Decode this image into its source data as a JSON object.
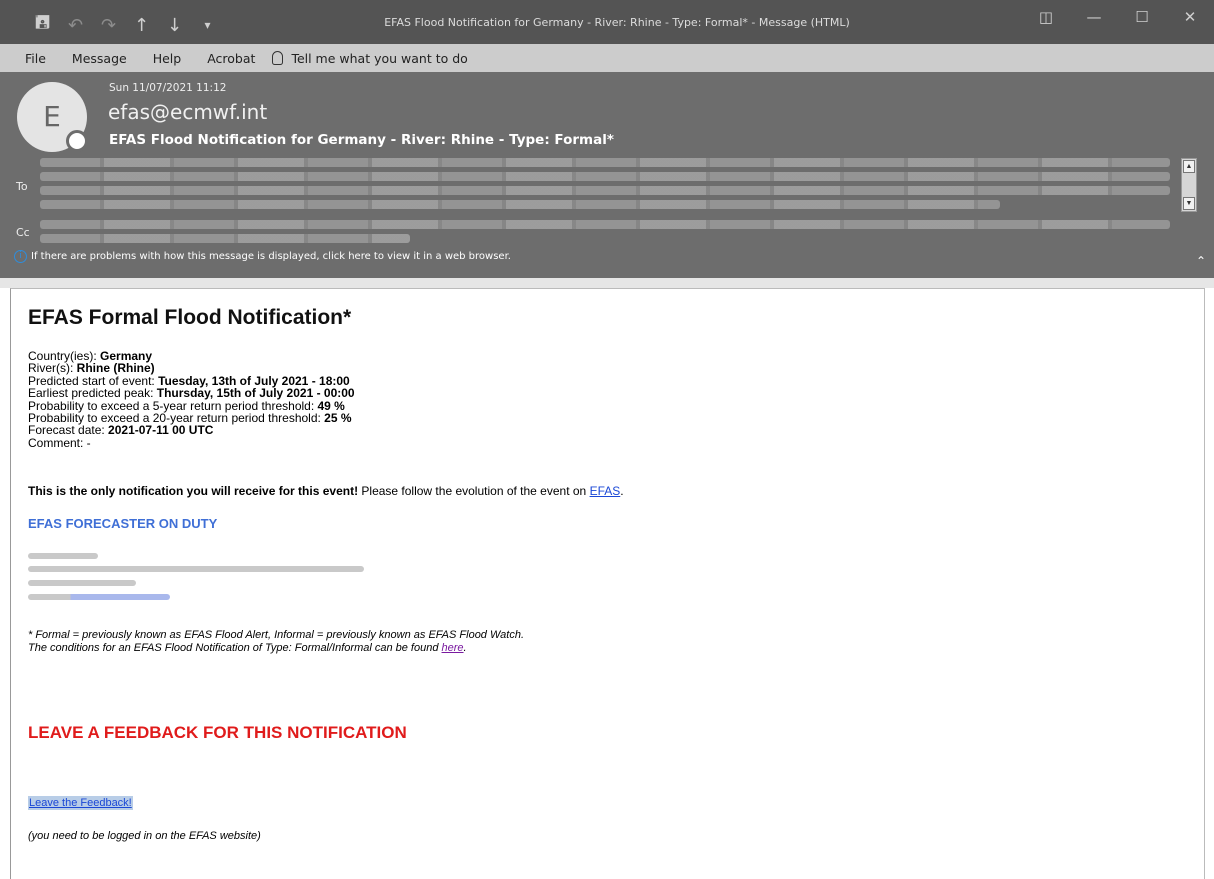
{
  "titlebar": {
    "title": "EFAS Flood Notification for Germany - River: Rhine - Type: Formal* - Message (HTML)",
    "qat_icons": [
      "save-icon",
      "undo-icon",
      "redo-icon",
      "up-arrow-icon",
      "down-arrow-icon",
      "customize-qat-icon"
    ]
  },
  "menu": {
    "items": [
      "File",
      "Message",
      "Help",
      "Acrobat"
    ],
    "tell_me": "Tell me what you want to do"
  },
  "header": {
    "avatar_letter": "E",
    "date": "Sun 11/07/2021 11:12",
    "sender": "efas@ecmwf.int",
    "subject": "EFAS Flood Notification for Germany - River: Rhine - Type: Formal*",
    "to_label": "To",
    "cc_label": "Cc",
    "info": "If there are problems with how this message is displayed, click here to view it in a web browser."
  },
  "body": {
    "heading": "EFAS Formal Flood Notification*",
    "details": [
      {
        "label": "Country(ies): ",
        "value": "Germany",
        "suffix": ""
      },
      {
        "label": "River(s): ",
        "value": "Rhine (Rhine)",
        "suffix": ""
      },
      {
        "label": "Predicted start of event: ",
        "value": "Tuesday, 13th of July 2021",
        "suffix": " - 18:00"
      },
      {
        "label": "Earliest predicted peak: ",
        "value": "Thursday, 15th of July 2021",
        "suffix": " - 00:00"
      },
      {
        "label": "Probability to exceed a 5-year return period threshold: ",
        "value": "49 %",
        "suffix": ""
      },
      {
        "label": "Probability to exceed a 20-year return period threshold: ",
        "value": "25 %",
        "suffix": ""
      },
      {
        "label": "Forecast date: ",
        "value": "2021-07-11 00 UTC",
        "suffix": ""
      },
      {
        "label": "Comment: -",
        "value": "",
        "suffix": ""
      }
    ],
    "only_bold": "This is the only notification you will receive for this event!",
    "only_rest": " Please follow the evolution of the event on ",
    "efas_link": "EFAS",
    "forecaster_heading": "EFAS FORECASTER ON DUTY",
    "footnote_line1": "* Formal = previously known as EFAS Flood Alert, Informal = previously known as EFAS Flood Watch.",
    "footnote_line2": "The conditions for an EFAS Flood Notification of Type: Formal/Informal can be found ",
    "here_link": "here",
    "feedback_heading": "LEAVE A FEEDBACK FOR THIS NOTIFICATION",
    "feedback_link": "Leave the Feedback!",
    "logged_in_note": "(you need to be logged in on the EFAS website)"
  },
  "colors": {
    "titlebar_bg": "#545454",
    "header_bg": "#6d6d6d",
    "menubar_bg": "#cccccc",
    "forecaster_blue": "#3f6fd6",
    "feedback_red": "#e01b1b"
  }
}
